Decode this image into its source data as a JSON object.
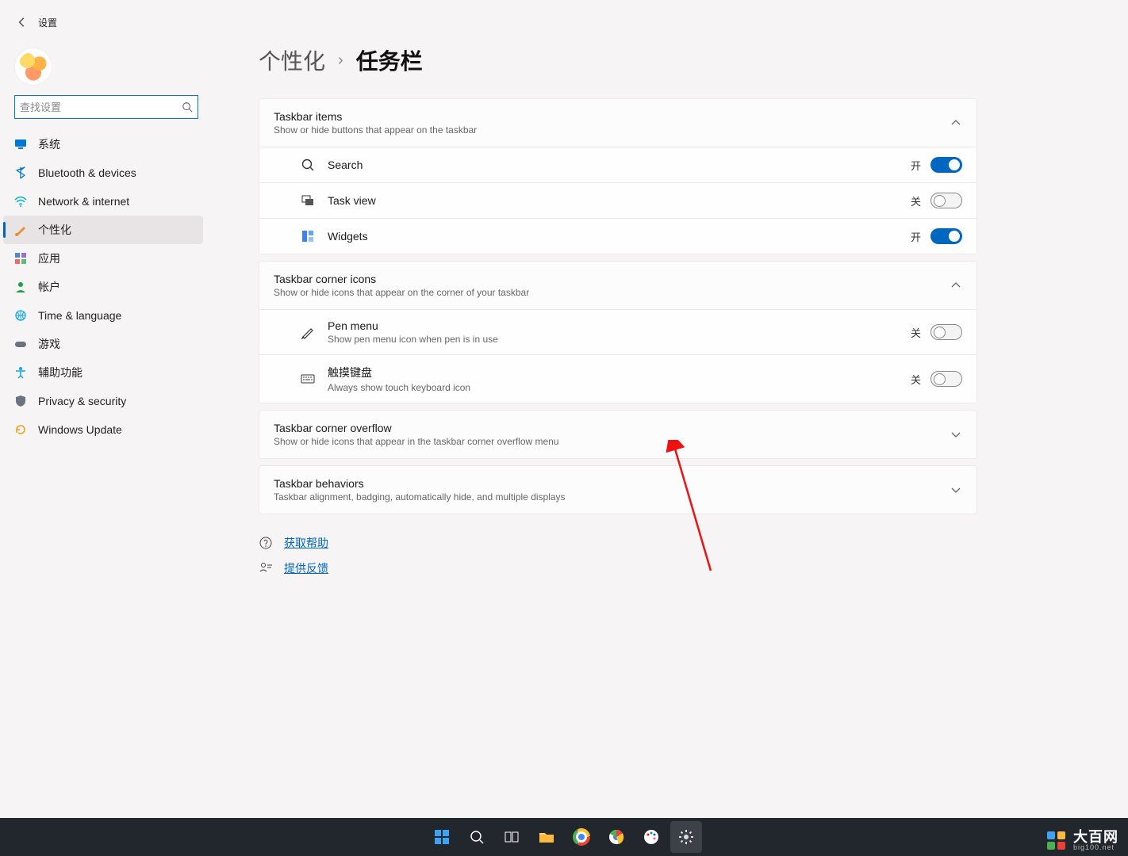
{
  "app_title": "设置",
  "search_placeholder": "查找设置",
  "nav_items": [
    {
      "label": "系统",
      "icon": "monitor",
      "color": "#0078d4"
    },
    {
      "label": "Bluetooth & devices",
      "icon": "bluetooth",
      "color": "#0078d4"
    },
    {
      "label": "Network & internet",
      "icon": "wifi",
      "color": "#00b7c3"
    },
    {
      "label": "个性化",
      "icon": "brush",
      "color": "#e8912d",
      "active": true
    },
    {
      "label": "应用",
      "icon": "apps",
      "color": "#7b61ff"
    },
    {
      "label": "帐户",
      "icon": "account",
      "color": "#16a34a"
    },
    {
      "label": "Time & language",
      "icon": "globe",
      "color": "#0ea5e9"
    },
    {
      "label": "游戏",
      "icon": "game",
      "color": "#6b7280"
    },
    {
      "label": "辅助功能",
      "icon": "accessibility",
      "color": "#0ea5e9"
    },
    {
      "label": "Privacy & security",
      "icon": "shield",
      "color": "#6b7280"
    },
    {
      "label": "Windows Update",
      "icon": "update",
      "color": "#f59e0b"
    }
  ],
  "breadcrumb": {
    "parent": "个性化",
    "current": "任务栏"
  },
  "sections": {
    "items": {
      "title": "Taskbar items",
      "subtitle": "Show or hide buttons that appear on the taskbar",
      "rows": [
        {
          "label": "Search",
          "icon": "search",
          "state_label": "开",
          "on": true
        },
        {
          "label": "Task view",
          "icon": "taskview",
          "state_label": "关",
          "on": false
        },
        {
          "label": "Widgets",
          "icon": "widgets",
          "state_label": "开",
          "on": true
        }
      ]
    },
    "corner": {
      "title": "Taskbar corner icons",
      "subtitle": "Show or hide icons that appear on the corner of your taskbar",
      "rows": [
        {
          "label": "Pen menu",
          "sub": "Show pen menu icon when pen is in use",
          "icon": "pen",
          "state_label": "关",
          "on": false
        },
        {
          "label": "触摸键盘",
          "sub": "Always show touch keyboard icon",
          "icon": "keyboard",
          "state_label": "关",
          "on": false
        }
      ]
    },
    "overflow": {
      "title": "Taskbar corner overflow",
      "subtitle": "Show or hide icons that appear in the taskbar corner overflow menu"
    },
    "behaviors": {
      "title": "Taskbar behaviors",
      "subtitle": "Taskbar alignment, badging, automatically hide, and multiple displays"
    }
  },
  "help": {
    "get_help": "获取帮助",
    "feedback": "提供反馈"
  },
  "taskbar_apps": [
    "start",
    "search",
    "taskview",
    "explorer",
    "chrome1",
    "chrome2",
    "paint",
    "settings"
  ],
  "watermark": {
    "name": "大百网",
    "sub": "big100.net"
  }
}
